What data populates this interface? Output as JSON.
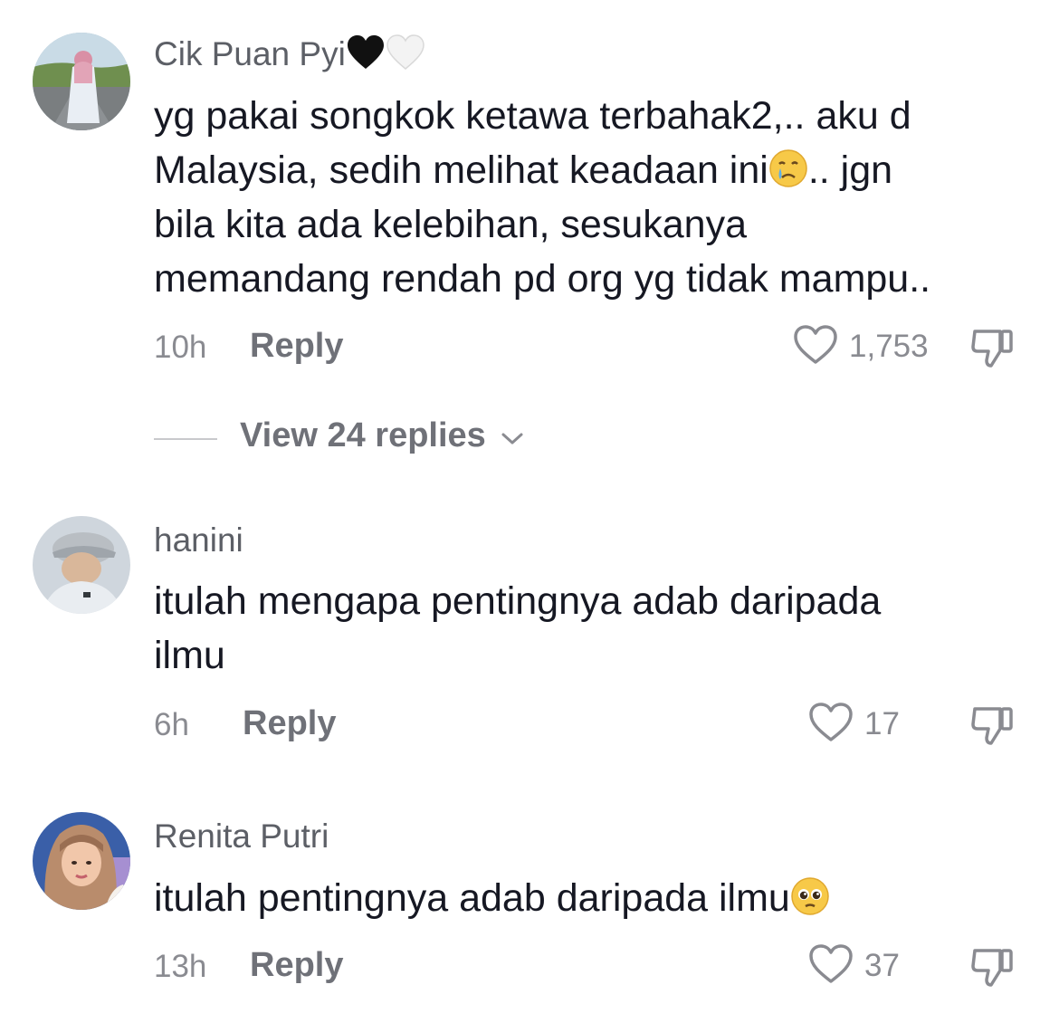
{
  "comments": [
    {
      "username": "Cik Puan Pyi",
      "username_emojis": [
        "black-heart-icon",
        "white-heart-icon"
      ],
      "text_lines": [
        "yg pakai songkok ketawa terbahak2,.. aku d",
        "Malaysia, sedih melihat keadaan ini",
        ".. jgn",
        "bila kita ada kelebihan, sesukanya",
        "memandang rendah pd org yg tidak mampu.."
      ],
      "emoji": "crying-face-icon",
      "time": "10h",
      "reply_label": "Reply",
      "likes": "1,753",
      "view_replies": "View 24 replies"
    },
    {
      "username": "hanini",
      "text_lines": [
        "itulah mengapa pentingnya adab daripada",
        "ilmu"
      ],
      "time": "6h",
      "reply_label": "Reply",
      "likes": "17"
    },
    {
      "username": "Renita Putri",
      "text_lines": [
        "itulah pentingnya adab daripada ilmu"
      ],
      "emoji": "pleading-face-icon",
      "time": "13h",
      "reply_label": "Reply",
      "likes": "37"
    }
  ],
  "icons": {
    "like": "heart-outline-icon",
    "dislike": "thumbs-down-icon",
    "expand": "chevron-down-icon"
  }
}
